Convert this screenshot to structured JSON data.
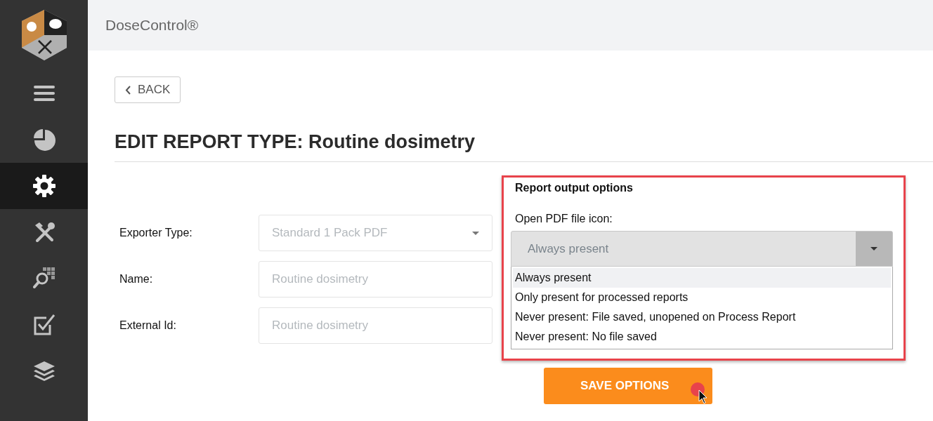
{
  "app": {
    "title": "DoseControl®"
  },
  "sidebar": {
    "items": [
      {
        "kind": "menu",
        "selected": false
      },
      {
        "kind": "chart",
        "selected": false
      },
      {
        "kind": "settings",
        "selected": true
      },
      {
        "kind": "tools",
        "selected": false
      },
      {
        "kind": "inspect",
        "selected": false
      },
      {
        "kind": "checklist",
        "selected": false
      },
      {
        "kind": "layers",
        "selected": false
      }
    ]
  },
  "back_button": {
    "label": "BACK"
  },
  "page_title": "EDIT REPORT TYPE: Routine dosimetry",
  "form": {
    "fields": [
      {
        "kind": "select",
        "label": "Exporter Type:",
        "value": "Standard 1 Pack PDF",
        "disabled": true
      },
      {
        "kind": "text",
        "label": "Name:",
        "value": "Routine dosimetry",
        "disabled": true
      },
      {
        "kind": "text",
        "label": "External Id:",
        "value": "Routine dosimetry",
        "disabled": true
      }
    ]
  },
  "output_options": {
    "title": "Report output options",
    "field_label": "Open PDF file icon:",
    "value": "Always present",
    "expanded": true,
    "options": [
      {
        "label": "Always present",
        "selected": true
      },
      {
        "label": "Only present for processed reports",
        "selected": false
      },
      {
        "label": "Never present: File saved, unopened on Process Report",
        "selected": false
      },
      {
        "label": "Never present: No file saved",
        "selected": false
      }
    ]
  },
  "save_button": {
    "label": "SAVE OPTIONS"
  }
}
